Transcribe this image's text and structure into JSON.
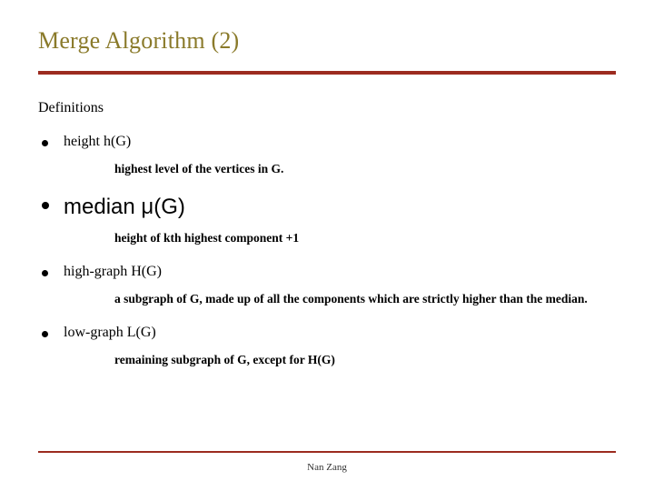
{
  "title": "Merge Algorithm (2)",
  "section_label": "Definitions",
  "items": [
    {
      "term": "height h(G)",
      "size": "sm",
      "desc": "highest level of the vertices in G."
    },
    {
      "term": "median μ(G)",
      "size": "lg",
      "desc": "height of kth highest component +1"
    },
    {
      "term": "high-graph H(G)",
      "size": "sm",
      "desc": "a subgraph of G, made up of all the components which are strictly higher than the median."
    },
    {
      "term": "low-graph L(G)",
      "size": "sm",
      "desc": "remaining subgraph of G, except for H(G)"
    }
  ],
  "footer": "Nan Zang"
}
